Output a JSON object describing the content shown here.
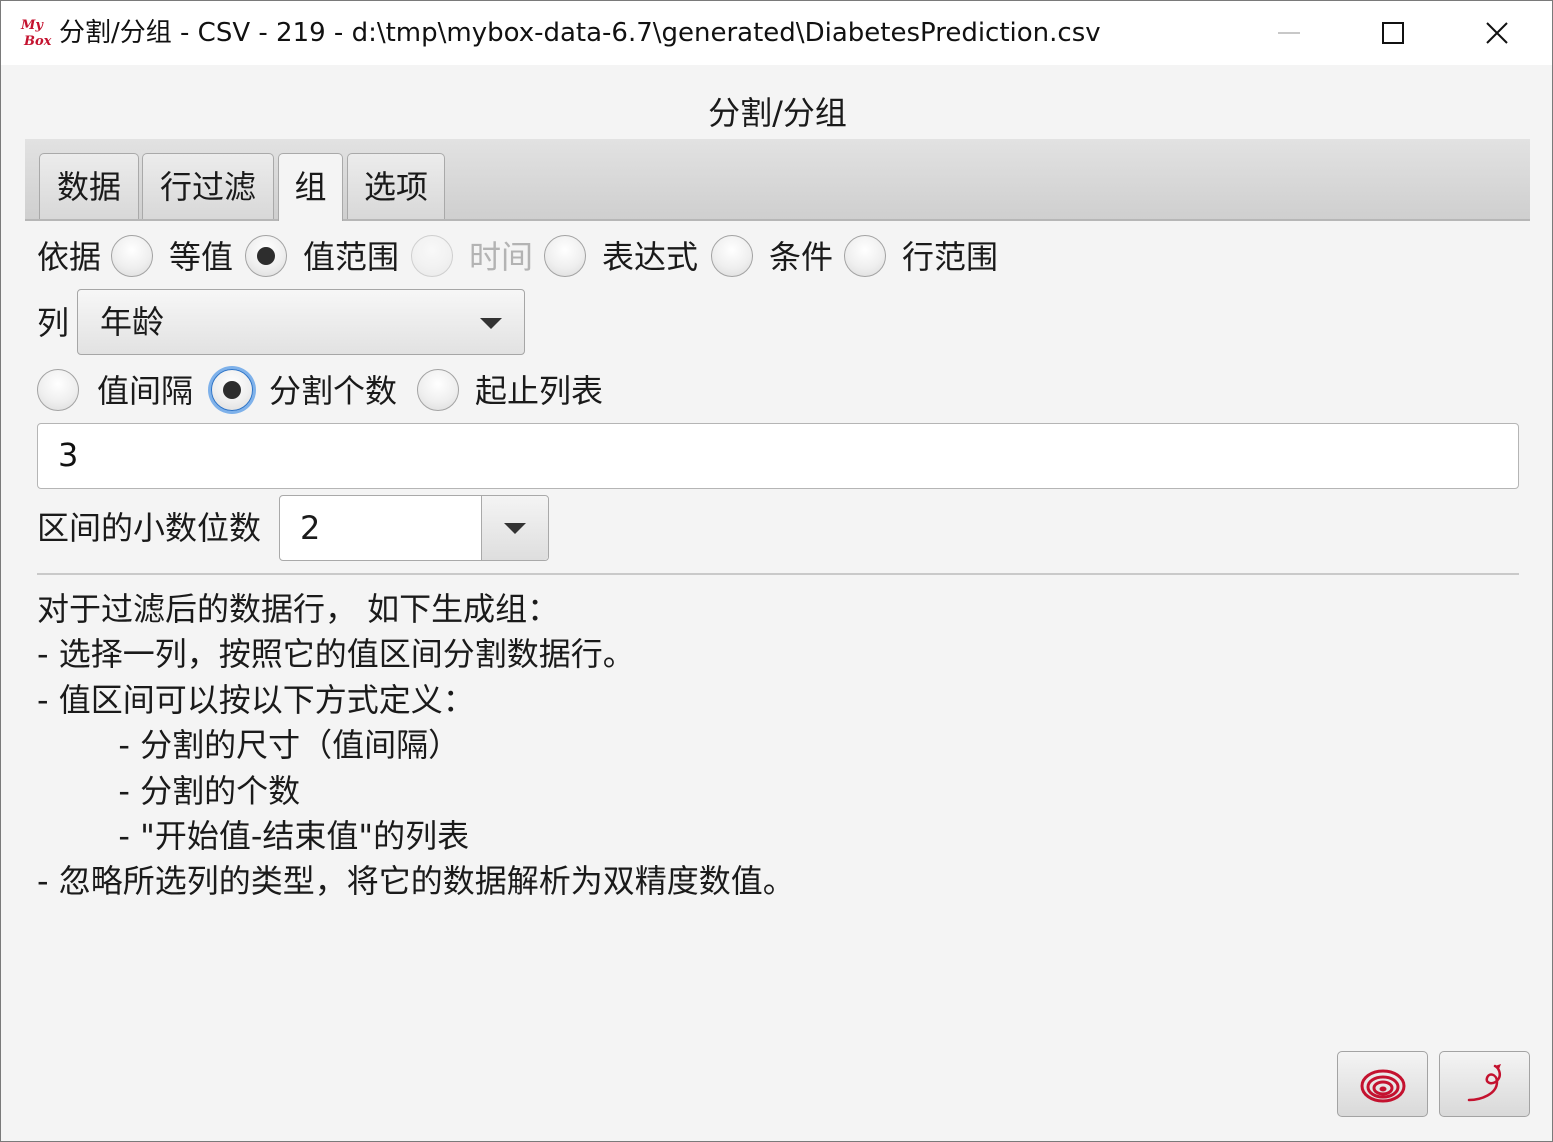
{
  "window": {
    "app_logo_text_top": "My",
    "app_logo_text_bottom": "Box",
    "title": "分割/分组 - CSV - 219 - d:\\tmp\\mybox-data-6.7\\generated\\DiabetesPrediction.csv"
  },
  "panel": {
    "title": "分割/分组"
  },
  "tabs": [
    {
      "label": "数据"
    },
    {
      "label": "行过滤"
    },
    {
      "label": "组",
      "selected": true
    },
    {
      "label": "选项"
    }
  ],
  "basis": {
    "label": "依据",
    "options": [
      {
        "label": "等值",
        "checked": false
      },
      {
        "label": "值范围",
        "checked": true
      },
      {
        "label": "时间",
        "checked": false,
        "disabled": true
      },
      {
        "label": "表达式",
        "checked": false
      },
      {
        "label": "条件",
        "checked": false
      },
      {
        "label": "行范围",
        "checked": false
      }
    ]
  },
  "column": {
    "label": "列",
    "selected": "年龄"
  },
  "split_method": {
    "options": [
      {
        "label": "值间隔",
        "checked": false
      },
      {
        "label": "分割个数",
        "checked": true
      },
      {
        "label": "起止列表",
        "checked": false
      }
    ]
  },
  "split_value": "3",
  "decimal": {
    "label": "区间的小数位数",
    "value": "2"
  },
  "description": [
    "对于过滤后的数据行， 如下生成组：",
    "- 选择一列，按照它的值区间分割数据行。",
    "- 值区间可以按以下方式定义：",
    "        - 分割的尺寸（值间隔）",
    "        - 分割的个数",
    "        - \"开始值-结束值\"的列表",
    "- 忽略所选列的类型，将它的数据解析为双精度数值。"
  ],
  "colors": {
    "accent": "#c4122f",
    "focus": "#2a72c7"
  },
  "icons": {
    "bottom_left": "swirl-icon",
    "bottom_right": "snake-icon"
  }
}
